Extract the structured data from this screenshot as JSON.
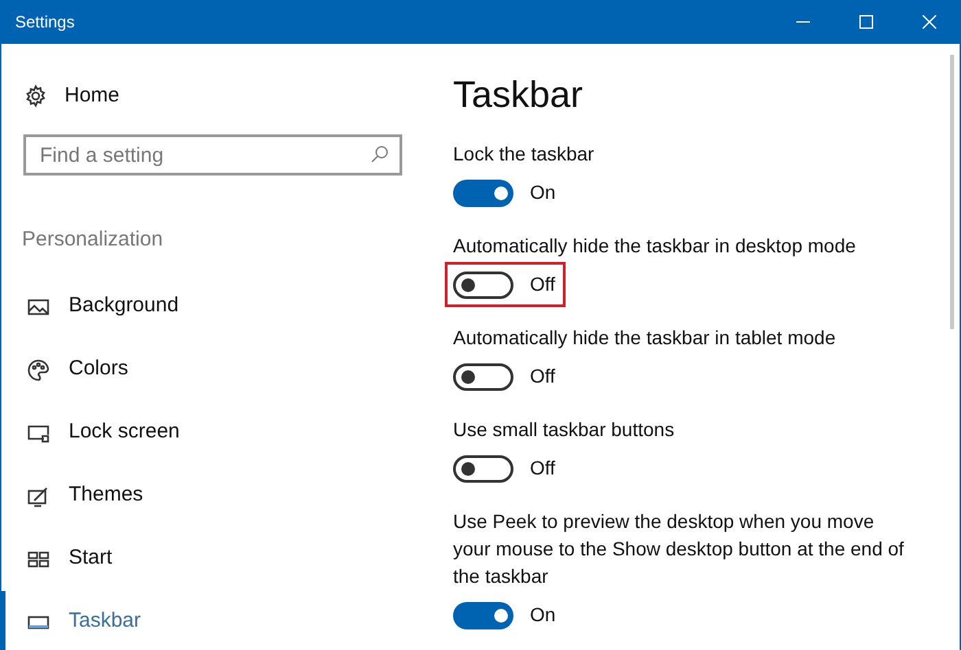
{
  "window": {
    "title": "Settings"
  },
  "sidebar": {
    "home": "Home",
    "search": {
      "placeholder": "Find a setting"
    },
    "section": "Personalization",
    "items": [
      {
        "label": "Background",
        "kind": "background",
        "selected": false
      },
      {
        "label": "Colors",
        "kind": "colors",
        "selected": false
      },
      {
        "label": "Lock screen",
        "kind": "lockscreen",
        "selected": false
      },
      {
        "label": "Themes",
        "kind": "themes",
        "selected": false
      },
      {
        "label": "Start",
        "kind": "start",
        "selected": false
      },
      {
        "label": "Taskbar",
        "kind": "taskbar",
        "selected": true
      }
    ]
  },
  "page": {
    "title": "Taskbar",
    "settings": [
      {
        "label": "Lock the taskbar",
        "on": true,
        "state": "On",
        "highlighted": false
      },
      {
        "label": "Automatically hide the taskbar in desktop mode",
        "on": false,
        "state": "Off",
        "highlighted": true
      },
      {
        "label": "Automatically hide the taskbar in tablet mode",
        "on": false,
        "state": "Off",
        "highlighted": false
      },
      {
        "label": "Use small taskbar buttons",
        "on": false,
        "state": "Off",
        "highlighted": false
      },
      {
        "label": "Use Peek to preview the desktop when you move your mouse to the Show desktop button at the end of the taskbar",
        "on": true,
        "state": "On",
        "highlighted": false
      }
    ]
  }
}
